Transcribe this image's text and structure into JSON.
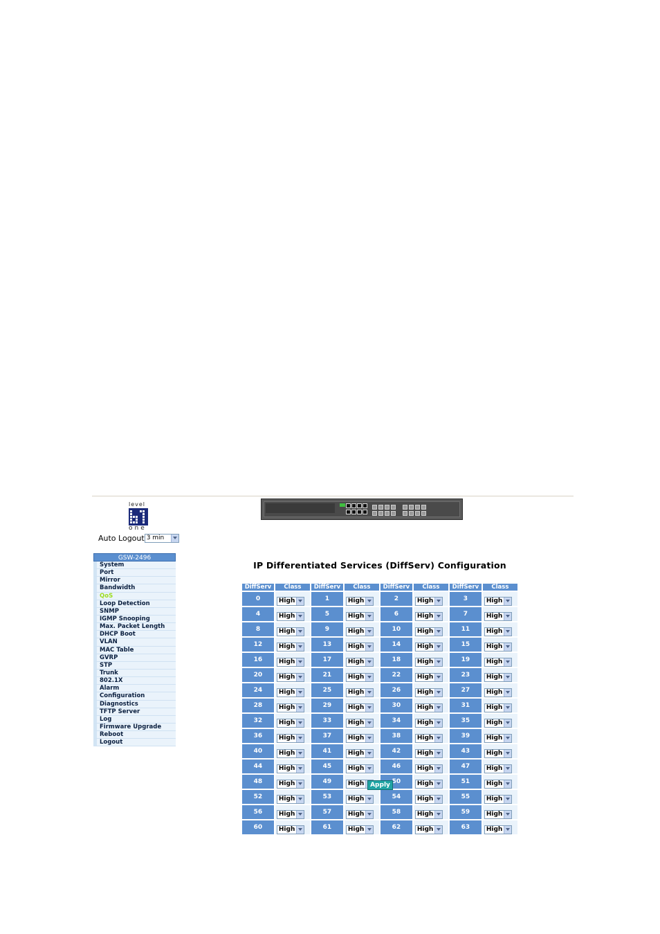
{
  "brand": {
    "level": "level",
    "one": "one",
    "sup": "1"
  },
  "auto_logout": {
    "label": "Auto Logout",
    "value": "3 min"
  },
  "sidebar": {
    "header": "GSW-2496",
    "active": "QoS",
    "items": [
      "System",
      "Port",
      "Mirror",
      "Bandwidth",
      "QoS",
      "Loop Detection",
      "SNMP",
      "IGMP Snooping",
      "Max. Packet Length",
      "DHCP Boot",
      "VLAN",
      "MAC Table",
      "GVRP",
      "STP",
      "Trunk",
      "802.1X",
      "Alarm",
      "Configuration",
      "Diagnostics",
      "TFTP Server",
      "Log",
      "Firmware Upgrade",
      "Reboot",
      "Logout"
    ]
  },
  "main": {
    "title": "IP Differentiated Services (DiffServ) Configuration",
    "columns": [
      "DiffServ",
      "Class",
      "DiffServ",
      "Class",
      "DiffServ",
      "Class",
      "DiffServ",
      "Class"
    ],
    "default_class": "High",
    "diffserv_values": [
      0,
      1,
      2,
      3,
      4,
      5,
      6,
      7,
      8,
      9,
      10,
      11,
      12,
      13,
      14,
      15,
      16,
      17,
      18,
      19,
      20,
      21,
      22,
      23,
      24,
      25,
      26,
      27,
      28,
      29,
      30,
      31,
      32,
      33,
      34,
      35,
      36,
      37,
      38,
      39,
      40,
      41,
      42,
      43,
      44,
      45,
      46,
      47,
      48,
      49,
      50,
      51,
      52,
      53,
      54,
      55,
      56,
      57,
      58,
      59,
      60,
      61,
      62,
      63
    ],
    "apply_label": "Apply"
  },
  "colors": {
    "header_blue": "#5b8fcf",
    "row_light": "#eaf3fb",
    "active_item": "#9ddc1e",
    "apply_teal": "#1fa4a4"
  }
}
